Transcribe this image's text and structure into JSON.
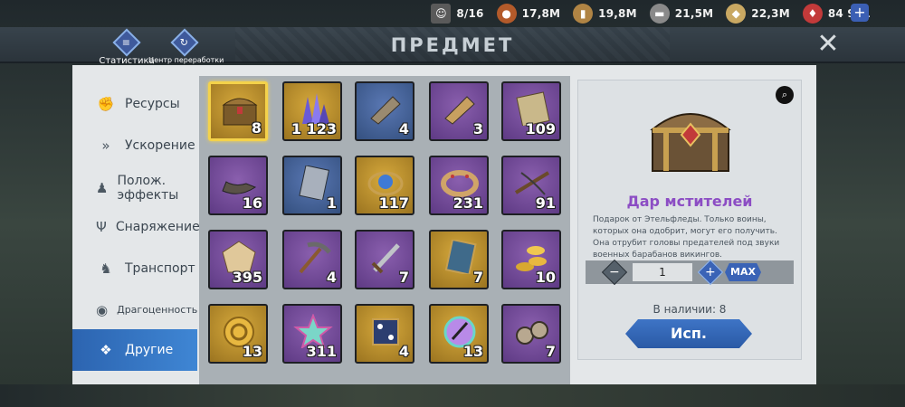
{
  "resources": [
    {
      "icon": "player-portrait-icon",
      "value": "8/16",
      "color": "#6b6b6b"
    },
    {
      "icon": "meat-icon",
      "value": "17,8M",
      "color": "#b35a2a"
    },
    {
      "icon": "wood-icon",
      "value": "19,8M",
      "color": "#b08444"
    },
    {
      "icon": "iron-icon",
      "value": "21,5M",
      "color": "#8a8a8a"
    },
    {
      "icon": "silver-icon",
      "value": "22,3M",
      "color": "#c9a862"
    },
    {
      "icon": "ruby-icon",
      "value": "84 981",
      "color": "#c23a3a"
    }
  ],
  "header": {
    "title": "ПРЕДМЕТ",
    "tabs": [
      {
        "label": "Статистика",
        "icon": "list-icon"
      },
      {
        "label": "Центр переработки",
        "icon": "recycle-icon"
      }
    ]
  },
  "sidebar": {
    "items": [
      {
        "label": "Ресурсы",
        "icon": "fist-icon"
      },
      {
        "label": "Ускорение",
        "icon": "fast-forward-icon"
      },
      {
        "label": "Полож. эффекты",
        "icon": "figure-icon"
      },
      {
        "label": "Снаряжение",
        "icon": "trident-icon"
      },
      {
        "label": "Транспорт",
        "icon": "horse-icon"
      },
      {
        "label": "Драгоценность",
        "icon": "gem-icon"
      },
      {
        "label": "Другие",
        "icon": "dots-icon"
      }
    ]
  },
  "items": [
    {
      "name": "treasure-chest",
      "count": "8",
      "bg": "gold"
    },
    {
      "name": "crystals",
      "count": "1 123",
      "bg": "gold"
    },
    {
      "name": "horn",
      "count": "4",
      "bg": "blue"
    },
    {
      "name": "horn",
      "count": "3",
      "bg": "purple"
    },
    {
      "name": "card",
      "count": "109",
      "bg": "purple"
    },
    {
      "name": "lamp",
      "count": "16",
      "bg": "purple"
    },
    {
      "name": "card",
      "count": "1",
      "bg": "blue"
    },
    {
      "name": "emblem",
      "count": "117",
      "bg": "gold"
    },
    {
      "name": "ring",
      "count": "231",
      "bg": "purple"
    },
    {
      "name": "crossbow",
      "count": "91",
      "bg": "purple"
    },
    {
      "name": "dice",
      "count": "395",
      "bg": "purple"
    },
    {
      "name": "pickaxe",
      "count": "4",
      "bg": "purple"
    },
    {
      "name": "sword",
      "count": "7",
      "bg": "purple"
    },
    {
      "name": "card",
      "count": "7",
      "bg": "gold"
    },
    {
      "name": "gold-coins",
      "count": "10",
      "bg": "purple"
    },
    {
      "name": "gold-coin",
      "count": "13",
      "bg": "gold"
    },
    {
      "name": "star",
      "count": "311",
      "bg": "purple"
    },
    {
      "name": "dice",
      "count": "4",
      "bg": "gold"
    },
    {
      "name": "orb",
      "count": "13",
      "bg": "gold"
    },
    {
      "name": "binoculars",
      "count": "7",
      "bg": "purple"
    }
  ],
  "detail": {
    "name": "Дар мстителей",
    "description": "Подарок от Этельфледы. Только воины, которых она одобрит, могут его получить. Она отрубит головы предателей под звуки военных барабанов викингов.",
    "quantity": "1",
    "max_label": "MAX",
    "stock": "В наличии: 8",
    "use_label": "Исп."
  },
  "colors": {
    "accent": "#3a63b6",
    "item_name": "#8c4dc4",
    "selected_border": "#f4d24a"
  }
}
